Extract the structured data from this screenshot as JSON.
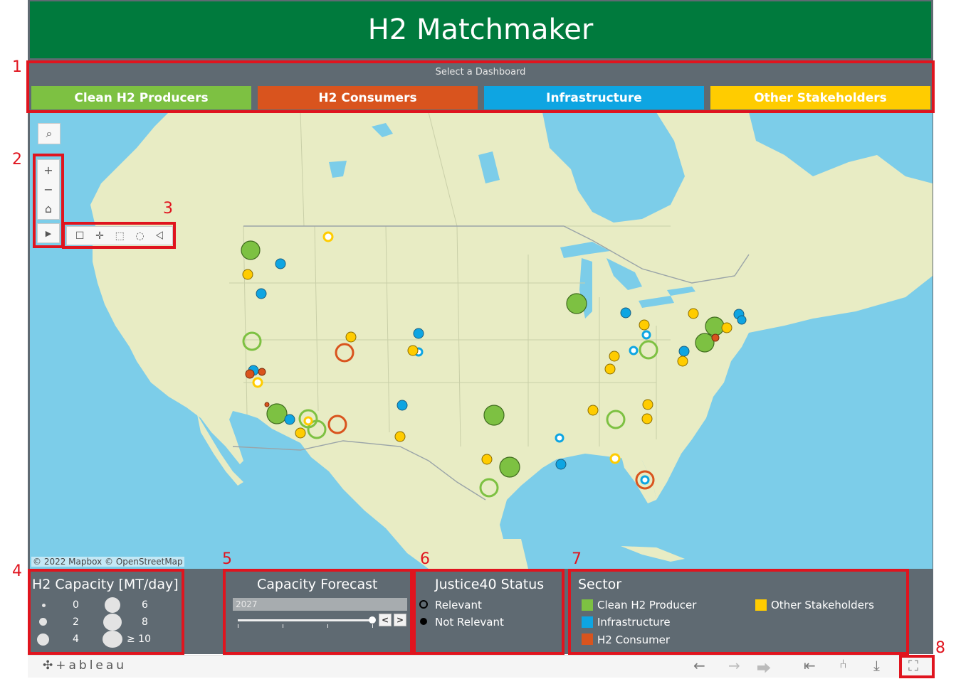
{
  "header": {
    "title": "H2 Matchmaker"
  },
  "dashboard_selector": {
    "label": "Select a Dashboard",
    "tabs": [
      {
        "label": "Clean H2 Producers",
        "color": "#7dc142"
      },
      {
        "label": "H2 Consumers",
        "color": "#d9541e"
      },
      {
        "label": "Infrastructure",
        "color": "#0ea5e2"
      },
      {
        "label": "Other Stakeholders",
        "color": "#ffcc00"
      }
    ]
  },
  "map": {
    "copyright": "© 2022 Mapbox  © OpenStreetMap",
    "controls": [
      "search-icon",
      "zoom-in-icon",
      "zoom-out-icon",
      "home-icon",
      "expand-toolbar-icon"
    ],
    "tools": [
      "rectangle-select-icon",
      "pan-icon",
      "rect-marquee-icon",
      "radial-select-icon",
      "lasso-icon"
    ]
  },
  "legend_capacity": {
    "title": "H2 Capacity [MT/day]",
    "sizes": [
      "0",
      "2",
      "4",
      "6",
      "8",
      "≥ 10"
    ]
  },
  "capacity_forecast": {
    "title": "Capacity Forecast",
    "value": "2027",
    "prev_symbol": "<",
    "next_symbol": ">"
  },
  "justice40": {
    "title": "Justice40 Status",
    "items": [
      "Relevant",
      "Not Relevant"
    ]
  },
  "sector": {
    "title": "Sector",
    "items": [
      {
        "label": "Clean H2 Producer",
        "color": "#7dc142"
      },
      {
        "label": "Infrastructure",
        "color": "#0ea5e2"
      },
      {
        "label": "H2 Consumer",
        "color": "#d9541e"
      },
      {
        "label": "Other Stakeholders",
        "color": "#ffcc00"
      }
    ]
  },
  "annotations": [
    "1",
    "2",
    "3",
    "4",
    "5",
    "6",
    "7",
    "8"
  ],
  "toolbar": {
    "logo": "+ableau",
    "icons": [
      "undo-icon",
      "redo-icon",
      "revert-icon",
      "reset-icon",
      "share-icon",
      "download-icon",
      "fullscreen-icon"
    ]
  },
  "colors": {
    "producer": "#7dc142",
    "infrastructure": "#0ea5e2",
    "consumer": "#d9541e",
    "other": "#ffcc00",
    "annotation": "#e0141e"
  }
}
